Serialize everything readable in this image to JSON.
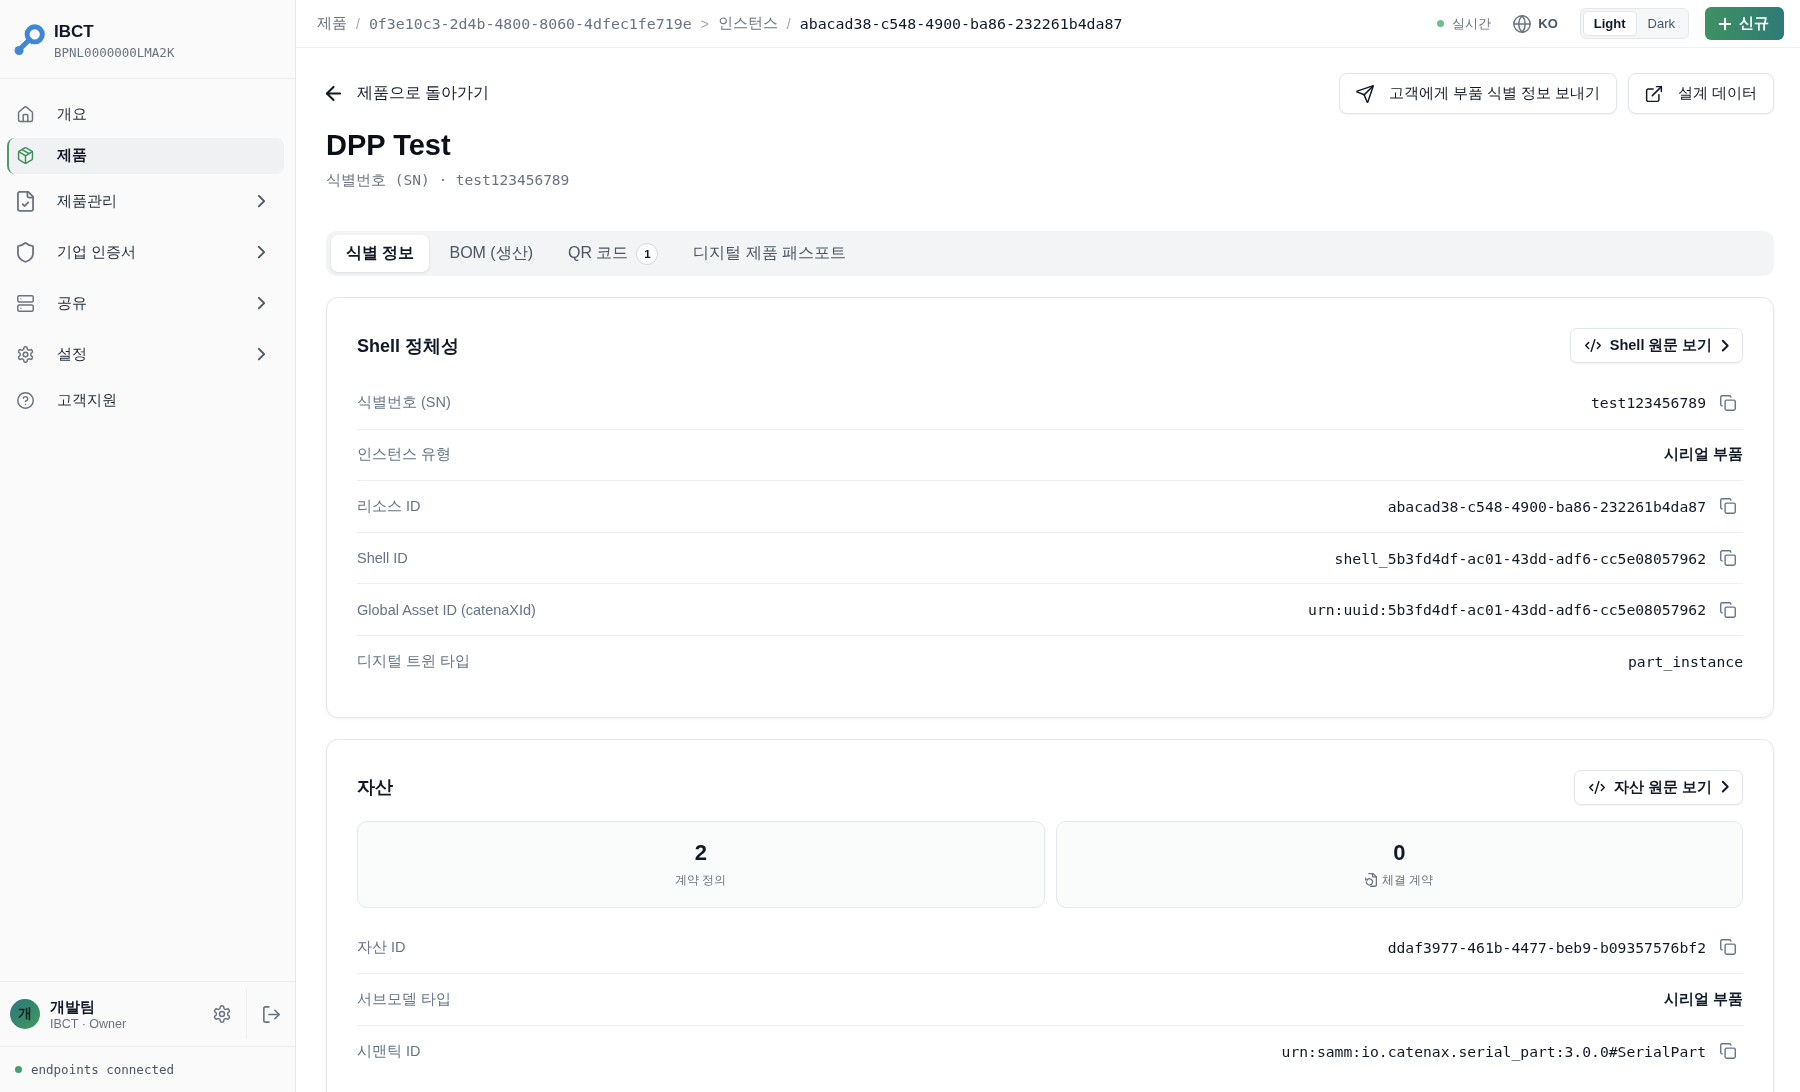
{
  "sidebar": {
    "brand": {
      "name": "IBCT",
      "id": "BPNL0000000LMA2K"
    },
    "nav": [
      {
        "label": "개요",
        "selected": false,
        "expandable": false
      },
      {
        "label": "제품",
        "selected": true,
        "expandable": false
      },
      {
        "label": "제품관리",
        "selected": false,
        "expandable": true
      },
      {
        "label": "기업 인증서",
        "selected": false,
        "expandable": true
      },
      {
        "label": "공유",
        "selected": false,
        "expandable": true
      },
      {
        "label": "설정",
        "selected": false,
        "expandable": true
      },
      {
        "label": "고객지원",
        "selected": false,
        "expandable": false
      }
    ],
    "user": {
      "initial": "개",
      "name": "개발팀",
      "role": "IBCT · Owner"
    },
    "status": {
      "text": "endpoints connected",
      "connected": true
    }
  },
  "topbar": {
    "breadcrumb": [
      {
        "label": "제품",
        "kind": "text",
        "current": false
      },
      {
        "separator": "/",
        "label": "0f3e10c3-2d4b-4800-8060-4dfec1fe719e",
        "kind": "id",
        "current": false
      },
      {
        "separator": ">",
        "label": "인스턴스",
        "kind": "text",
        "current": false
      },
      {
        "separator": "/",
        "label": "abacad38-c548-4900-ba86-232261b4da87",
        "kind": "id",
        "current": true
      }
    ],
    "live": {
      "label": "실시간",
      "on": true
    },
    "language": "KO",
    "theme": [
      {
        "label": "Light",
        "selected": true
      },
      {
        "label": "Dark",
        "selected": false
      }
    ],
    "new_button": "신규"
  },
  "header": {
    "back": "제품으로 돌아가기",
    "actions": [
      "고객에게 부품 식별 정보 보내기",
      "설계 데이터"
    ],
    "title": "DPP Test",
    "subtitle": "식별번호 (SN) · test123456789"
  },
  "tabs": [
    {
      "label": "식별 정보",
      "selected": true
    },
    {
      "label": "BOM (생산)",
      "selected": false
    },
    {
      "label": "QR 코드",
      "badge": "1",
      "selected": false
    },
    {
      "label": "디지털 제품 패스포트",
      "selected": false
    }
  ],
  "cards": [
    {
      "title": "Shell 정체성",
      "button": "Shell 원문 보기",
      "rows": [
        {
          "label": "식별번호 (SN)",
          "value": "test123456789",
          "kind": "id"
        },
        {
          "label": "인스턴스 유형",
          "value": "시리얼 부품",
          "kind": "text"
        },
        {
          "label": "리소스 ID",
          "value": "abacad38-c548-4900-ba86-232261b4da87",
          "kind": "id"
        },
        {
          "label": "Shell ID",
          "value": "shell_5b3fd4df-ac01-43dd-adf6-cc5e08057962",
          "kind": "id"
        },
        {
          "label": "Global Asset ID (catenaXId)",
          "value": "urn:uuid:5b3fd4df-ac01-43dd-adf6-cc5e08057962",
          "kind": "id"
        },
        {
          "label": "디지털 트윈 타입",
          "value": "part_instance",
          "kind": "code"
        }
      ]
    },
    {
      "title": "자산",
      "button": "자산 원문 보기",
      "stats": [
        {
          "value": "2",
          "label": "계약 정의",
          "kind": "plain"
        },
        {
          "value": "0",
          "label": "체결 계약",
          "kind": "iconed"
        }
      ],
      "rows": [
        {
          "label": "자산 ID",
          "value": "ddaf3977-461b-4477-beb9-b09357576bf2",
          "kind": "id"
        },
        {
          "label": "서브모델 타입",
          "value": "시리얼 부품",
          "kind": "text"
        },
        {
          "label": "시맨틱 ID",
          "value": "urn:samm:io.catenax.serial_part:3.0.0#SerialPart",
          "kind": "id"
        }
      ]
    }
  ]
}
